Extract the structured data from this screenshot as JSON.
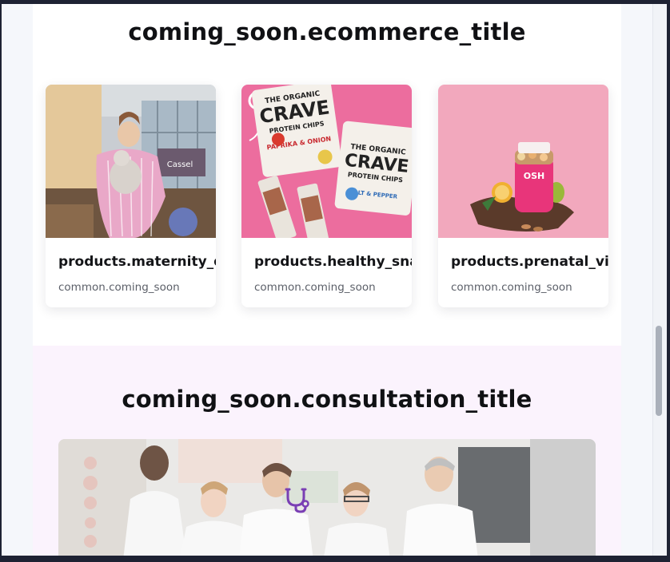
{
  "ecommerce": {
    "title": "coming_soon.ecommerce_title",
    "products": [
      {
        "name": "products.maternity_dre",
        "status": "common.coming_soon",
        "image": "maternity-dress-photo"
      },
      {
        "name": "products.healthy_snack",
        "status": "common.coming_soon",
        "image": "healthy-snack-photo"
      },
      {
        "name": "products.prenatal_vita",
        "status": "common.coming_soon",
        "image": "prenatal-vitamins-photo"
      }
    ],
    "card_text": {
      "crave_brand": "THE ORGANIC",
      "crave_name": "CRAVE",
      "crave_sub": "PROTEIN CHIPS",
      "crave_flavor1": "PAPRIKA & ONION",
      "crave_flavor2": "SALT & PEPPER",
      "osh_brand": "OSH",
      "cassel_sign": "Cassel"
    }
  },
  "consultation": {
    "title": "coming_soon.consultation_title",
    "image": "doctors-team-photo",
    "icon": "stethoscope-icon"
  },
  "colors": {
    "accent": "#7a3fb4",
    "section_bg": "#fbf3fd"
  }
}
